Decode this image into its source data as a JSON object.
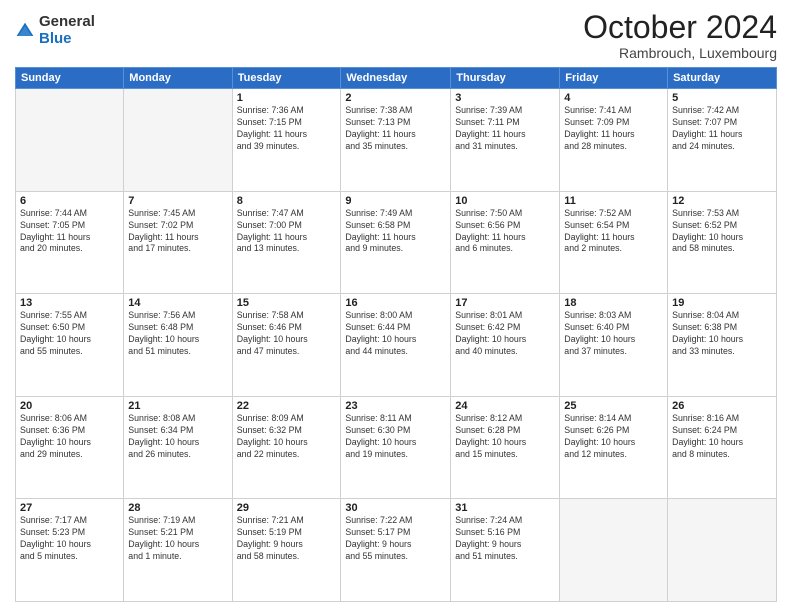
{
  "logo": {
    "general": "General",
    "blue": "Blue"
  },
  "header": {
    "month": "October 2024",
    "location": "Rambrouch, Luxembourg"
  },
  "weekdays": [
    "Sunday",
    "Monday",
    "Tuesday",
    "Wednesday",
    "Thursday",
    "Friday",
    "Saturday"
  ],
  "weeks": [
    [
      {
        "day": "",
        "info": ""
      },
      {
        "day": "",
        "info": ""
      },
      {
        "day": "1",
        "info": "Sunrise: 7:36 AM\nSunset: 7:15 PM\nDaylight: 11 hours\nand 39 minutes."
      },
      {
        "day": "2",
        "info": "Sunrise: 7:38 AM\nSunset: 7:13 PM\nDaylight: 11 hours\nand 35 minutes."
      },
      {
        "day": "3",
        "info": "Sunrise: 7:39 AM\nSunset: 7:11 PM\nDaylight: 11 hours\nand 31 minutes."
      },
      {
        "day": "4",
        "info": "Sunrise: 7:41 AM\nSunset: 7:09 PM\nDaylight: 11 hours\nand 28 minutes."
      },
      {
        "day": "5",
        "info": "Sunrise: 7:42 AM\nSunset: 7:07 PM\nDaylight: 11 hours\nand 24 minutes."
      }
    ],
    [
      {
        "day": "6",
        "info": "Sunrise: 7:44 AM\nSunset: 7:05 PM\nDaylight: 11 hours\nand 20 minutes."
      },
      {
        "day": "7",
        "info": "Sunrise: 7:45 AM\nSunset: 7:02 PM\nDaylight: 11 hours\nand 17 minutes."
      },
      {
        "day": "8",
        "info": "Sunrise: 7:47 AM\nSunset: 7:00 PM\nDaylight: 11 hours\nand 13 minutes."
      },
      {
        "day": "9",
        "info": "Sunrise: 7:49 AM\nSunset: 6:58 PM\nDaylight: 11 hours\nand 9 minutes."
      },
      {
        "day": "10",
        "info": "Sunrise: 7:50 AM\nSunset: 6:56 PM\nDaylight: 11 hours\nand 6 minutes."
      },
      {
        "day": "11",
        "info": "Sunrise: 7:52 AM\nSunset: 6:54 PM\nDaylight: 11 hours\nand 2 minutes."
      },
      {
        "day": "12",
        "info": "Sunrise: 7:53 AM\nSunset: 6:52 PM\nDaylight: 10 hours\nand 58 minutes."
      }
    ],
    [
      {
        "day": "13",
        "info": "Sunrise: 7:55 AM\nSunset: 6:50 PM\nDaylight: 10 hours\nand 55 minutes."
      },
      {
        "day": "14",
        "info": "Sunrise: 7:56 AM\nSunset: 6:48 PM\nDaylight: 10 hours\nand 51 minutes."
      },
      {
        "day": "15",
        "info": "Sunrise: 7:58 AM\nSunset: 6:46 PM\nDaylight: 10 hours\nand 47 minutes."
      },
      {
        "day": "16",
        "info": "Sunrise: 8:00 AM\nSunset: 6:44 PM\nDaylight: 10 hours\nand 44 minutes."
      },
      {
        "day": "17",
        "info": "Sunrise: 8:01 AM\nSunset: 6:42 PM\nDaylight: 10 hours\nand 40 minutes."
      },
      {
        "day": "18",
        "info": "Sunrise: 8:03 AM\nSunset: 6:40 PM\nDaylight: 10 hours\nand 37 minutes."
      },
      {
        "day": "19",
        "info": "Sunrise: 8:04 AM\nSunset: 6:38 PM\nDaylight: 10 hours\nand 33 minutes."
      }
    ],
    [
      {
        "day": "20",
        "info": "Sunrise: 8:06 AM\nSunset: 6:36 PM\nDaylight: 10 hours\nand 29 minutes."
      },
      {
        "day": "21",
        "info": "Sunrise: 8:08 AM\nSunset: 6:34 PM\nDaylight: 10 hours\nand 26 minutes."
      },
      {
        "day": "22",
        "info": "Sunrise: 8:09 AM\nSunset: 6:32 PM\nDaylight: 10 hours\nand 22 minutes."
      },
      {
        "day": "23",
        "info": "Sunrise: 8:11 AM\nSunset: 6:30 PM\nDaylight: 10 hours\nand 19 minutes."
      },
      {
        "day": "24",
        "info": "Sunrise: 8:12 AM\nSunset: 6:28 PM\nDaylight: 10 hours\nand 15 minutes."
      },
      {
        "day": "25",
        "info": "Sunrise: 8:14 AM\nSunset: 6:26 PM\nDaylight: 10 hours\nand 12 minutes."
      },
      {
        "day": "26",
        "info": "Sunrise: 8:16 AM\nSunset: 6:24 PM\nDaylight: 10 hours\nand 8 minutes."
      }
    ],
    [
      {
        "day": "27",
        "info": "Sunrise: 7:17 AM\nSunset: 5:23 PM\nDaylight: 10 hours\nand 5 minutes."
      },
      {
        "day": "28",
        "info": "Sunrise: 7:19 AM\nSunset: 5:21 PM\nDaylight: 10 hours\nand 1 minute."
      },
      {
        "day": "29",
        "info": "Sunrise: 7:21 AM\nSunset: 5:19 PM\nDaylight: 9 hours\nand 58 minutes."
      },
      {
        "day": "30",
        "info": "Sunrise: 7:22 AM\nSunset: 5:17 PM\nDaylight: 9 hours\nand 55 minutes."
      },
      {
        "day": "31",
        "info": "Sunrise: 7:24 AM\nSunset: 5:16 PM\nDaylight: 9 hours\nand 51 minutes."
      },
      {
        "day": "",
        "info": ""
      },
      {
        "day": "",
        "info": ""
      }
    ]
  ]
}
